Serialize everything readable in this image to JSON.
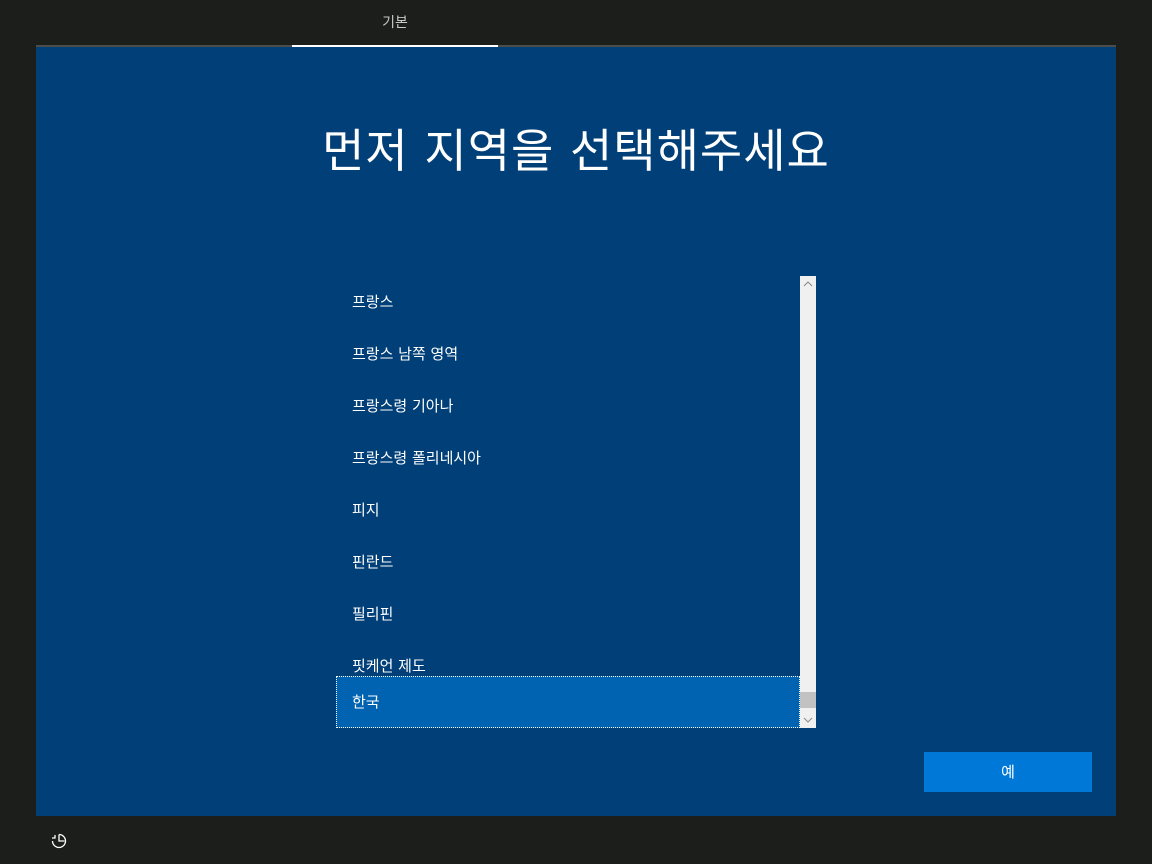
{
  "header": {
    "tab_label": "기본"
  },
  "main": {
    "title": "먼저 지역을 선택해주세요",
    "regions": [
      "프랑스",
      "프랑스 남쪽 영역",
      "프랑스령 기아나",
      "프랑스령 폴리네시아",
      "피지",
      "핀란드",
      "필리핀",
      "핏케언 제도",
      "한국"
    ],
    "selected_region": "한국",
    "confirm_label": "예"
  },
  "footer": {
    "icon": "accessibility-icon"
  },
  "colors": {
    "background": "#1b1e1b",
    "panel": "#003f77",
    "selected": "#0063b1",
    "button": "#0078d7"
  }
}
